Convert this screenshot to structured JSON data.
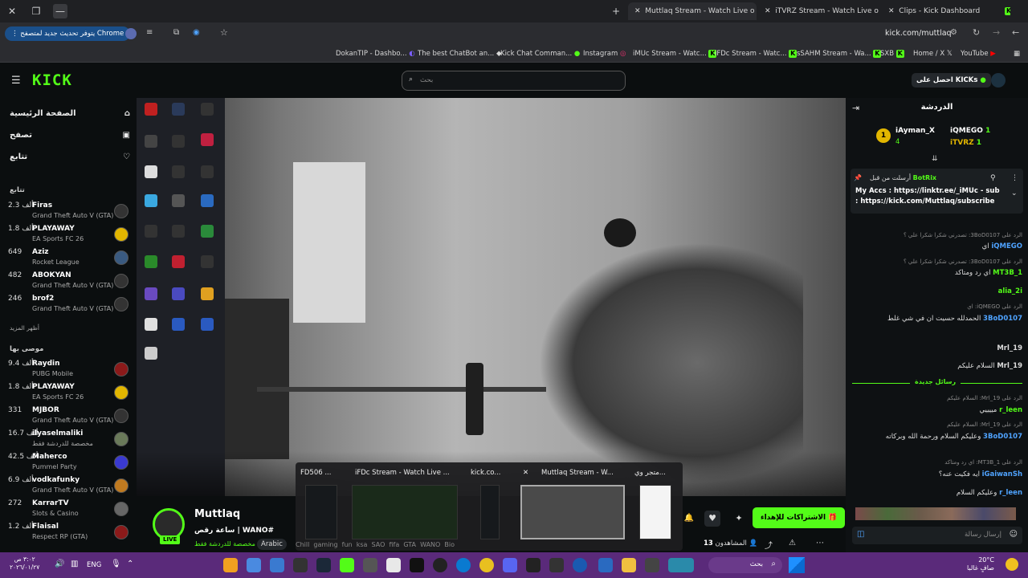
{
  "browser": {
    "tabs": [
      {
        "label": "Muttlaq Stream - Watch Live o",
        "active": true
      },
      {
        "label": "iTVRZ Stream - Watch Live on",
        "active": false
      },
      {
        "label": "Clips - Kick Dashboard",
        "active": false
      }
    ],
    "update_label": "يتوفر تحديث جديد لمتصفح Chrome",
    "url": "kick.com/muttlaq",
    "bookmarks": [
      "DokanTIP - Dashbo...",
      "The best ChatBot an...",
      "Kick Chat Comman...",
      "Instagram",
      "iMUc Stream - Watc...",
      "iFDc Stream - Watc...",
      "sSAHM Stream - Wa...",
      "SXB",
      "Home / X",
      "YouTube"
    ]
  },
  "kick": {
    "logo": "KICK",
    "search_placeholder": "بحث",
    "get_kicks": "احصل على KICKs",
    "nav": [
      "الصفحة الرئيسية",
      "تصفح",
      "تتابع"
    ],
    "following_title": "تتابع",
    "following": [
      {
        "name": "Firas",
        "viewers": "2.3 ألف",
        "game": "Grand Theft Auto V (GTA)"
      },
      {
        "name": "PLAYAWAY",
        "viewers": "1.8 ألف",
        "game": "EA Sports FC 26"
      },
      {
        "name": "Aziz",
        "viewers": "649",
        "game": "Rocket League"
      },
      {
        "name": "ABOKYAN",
        "viewers": "482",
        "game": "Grand Theft Auto V (GTA)"
      },
      {
        "name": "brof2",
        "viewers": "246",
        "game": "Grand Theft Auto V (GTA)"
      }
    ],
    "show_more": "أظهر المزيد",
    "recommended_title": "موصى بها",
    "recommended": [
      {
        "name": "Raydin",
        "viewers": "9.4 ألف",
        "game": "PUBG Mobile"
      },
      {
        "name": "PLAYAWAY",
        "viewers": "1.8 ألف",
        "game": "EA Sports FC 26"
      },
      {
        "name": "MJBOR",
        "viewers": "331",
        "game": "Grand Theft Auto V (GTA)"
      },
      {
        "name": "ilyaselmaliki",
        "viewers": "16.7 ألف",
        "game": "مخصصة للدردشة فقط"
      },
      {
        "name": "Maherco",
        "viewers": "42.5 ألف",
        "game": "Pummel Party"
      },
      {
        "name": "vodkafunky",
        "viewers": "6.9 ألف",
        "game": "Grand Theft Auto V (GTA)"
      },
      {
        "name": "KarrarTV",
        "viewers": "272",
        "game": "Slots & Casino"
      },
      {
        "name": "Flaisal",
        "viewers": "1.2 ألف",
        "game": "Respect RP (GTA)"
      }
    ],
    "streamer": {
      "name": "Muttlaq",
      "title": "ساعة رقص | WANO#",
      "category": "مخصصة للدردشة فقط",
      "language": "Arabic",
      "tags": [
        "Chill",
        "gaming",
        "fun",
        "ksa",
        "SAO",
        "fifa",
        "GTA",
        "WANO",
        "Bio"
      ],
      "subscribe": "الاشتراكات للإهداء",
      "viewers_label": "المشاهدون",
      "viewers": "13",
      "live": "LIVE"
    },
    "chat": {
      "title": "الدردشة",
      "gifters": [
        {
          "name": "iAyman_X",
          "count": "4"
        },
        {
          "name": "iQMEGO",
          "count": "1"
        },
        {
          "name": "iTVRZ",
          "count": "1"
        }
      ],
      "pinned_by": "أرسلت من قبل",
      "pinned_user": "BotRix",
      "pinned_text": "My Accs : https://linktr.ee/_iMUc - sub : https://kick.com/Muttlaq/subscribe",
      "new_messages": "رسائل جديدة",
      "messages": [
        {
          "reply": "الرد على 3BoD0107: تصدرني شكرا شكرا علي ؟",
          "user": "iQMEGO",
          "text": "اي",
          "color": "#4fa3ff"
        },
        {
          "reply": "الرد على 3BoD0107: تصدرني شكرا شكرا علي ؟",
          "user": "MT3B_1",
          "text": "اي رد ومتأكد",
          "color": "#53fc18"
        },
        {
          "reply": "",
          "user": "alia_2i",
          "text": "",
          "color": "#53fc18"
        },
        {
          "reply": "الرد على iQMEGO: اي",
          "user": "3BoD0107",
          "text": "الحمدلله حسيت ان في شي غلط",
          "color": "#4fa3ff"
        },
        {
          "reply": "",
          "user": "Mrl_19",
          "text": "",
          "color": "#ddd"
        },
        {
          "reply": "",
          "user": "Mrl_19",
          "text": "السلام عليكم",
          "color": "#ddd"
        },
        {
          "reply": "الرد على Mrl_19: السلام عليكم",
          "user": "r_leen",
          "text": "مييييي",
          "color": "#53fc18"
        },
        {
          "reply": "الرد على Mrl_19: السلام عليكم",
          "user": "3BoD0107",
          "text": "وعليكم السلام ورحمة الله وبركاته",
          "color": "#4fa3ff"
        },
        {
          "reply": "الرد على MT3B_1: اي رد ومتأكد",
          "user": "iGaiwanSh",
          "text": "ايه فكيت عنه؟",
          "color": "#4fa3ff"
        },
        {
          "reply": "",
          "user": "r_leen",
          "text": "وعليكم السلام",
          "color": "#4fa3ff"
        }
      ],
      "input_placeholder": "إرسال رسالة"
    }
  },
  "switcher": {
    "windows": [
      "FD506 ...",
      "iFDc Stream - Watch Live ...",
      "kick.co...",
      "Muttlaq Stream - W...",
      "متجر وي..."
    ]
  },
  "taskbar": {
    "search": "بحث",
    "lang": "ENG",
    "time": "٣:٠٢ ص",
    "date": "٢٠٢٦/٠١/٢٧",
    "weather": "20°C",
    "weather_desc": "صافٍ غالبا"
  },
  "colors": {
    "accent": "#53fc18",
    "taskbar": "#5a2a7a",
    "bg": "#0b0e0f"
  }
}
